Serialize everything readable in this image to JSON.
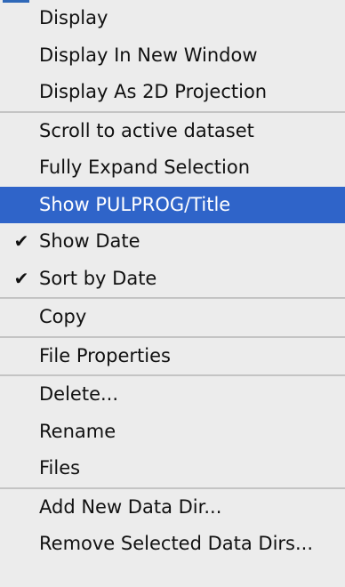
{
  "menu": {
    "groups": [
      {
        "items": [
          {
            "label": "Display"
          },
          {
            "label": "Display In New Window"
          },
          {
            "label": "Display As 2D Projection"
          }
        ]
      },
      {
        "items": [
          {
            "label": "Scroll to active dataset"
          },
          {
            "label": "Fully Expand Selection"
          },
          {
            "label": "Show PULPROG/Title",
            "highlighted": true
          },
          {
            "label": "Show Date",
            "checked": true
          },
          {
            "label": "Sort by Date",
            "checked": true
          }
        ]
      },
      {
        "items": [
          {
            "label": "Copy"
          }
        ]
      },
      {
        "items": [
          {
            "label": "File Properties"
          }
        ]
      },
      {
        "items": [
          {
            "label": "Delete..."
          },
          {
            "label": "Rename"
          },
          {
            "label": "Files"
          }
        ]
      },
      {
        "items": [
          {
            "label": "Add New Data Dir..."
          },
          {
            "label": "Remove Selected Data Dirs..."
          }
        ]
      }
    ],
    "check_glyph": "✔",
    "colors": {
      "background": "#ececec",
      "highlight": "#2f64c9",
      "separator": "#c4c4c4"
    }
  }
}
